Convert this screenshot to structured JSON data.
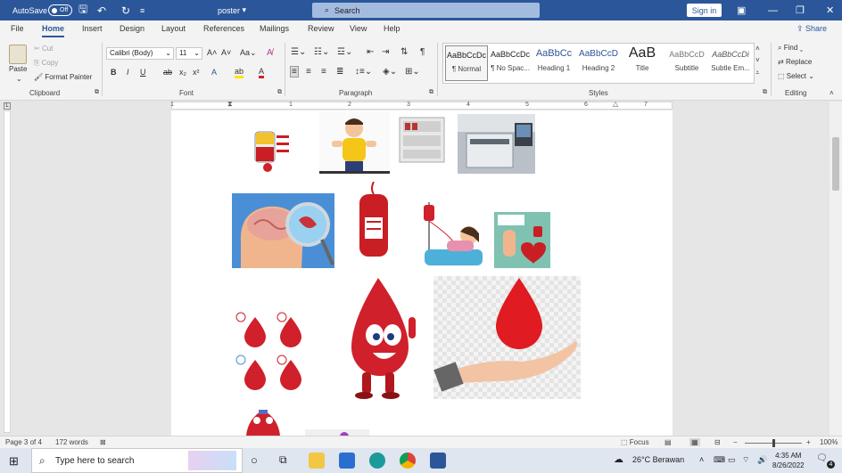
{
  "titlebar": {
    "autosave_label": "AutoSave",
    "autosave_state": "Off",
    "doc_title": "poster",
    "doc_title_caret": "▾",
    "search_placeholder": "Search",
    "sign_in": "Sign in"
  },
  "menu": {
    "tabs": [
      "File",
      "Home",
      "Insert",
      "Design",
      "Layout",
      "References",
      "Mailings",
      "Review",
      "View",
      "Help"
    ],
    "active": "Home",
    "share": "Share"
  },
  "ribbon": {
    "clipboard": {
      "paste": "Paste",
      "cut": "Cut",
      "copy": "Copy",
      "format_painter": "Format Painter",
      "label": "Clipboard"
    },
    "font": {
      "name": "Calibri (Body)",
      "size": "11",
      "label": "Font"
    },
    "paragraph": {
      "label": "Paragraph"
    },
    "styles": {
      "label": "Styles",
      "items": [
        {
          "sample": "AaBbCcDc",
          "name": "¶ Normal"
        },
        {
          "sample": "AaBbCcDc",
          "name": "¶ No Spac..."
        },
        {
          "sample": "AaBbCc",
          "name": "Heading 1"
        },
        {
          "sample": "AaBbCcD",
          "name": "Heading 2"
        },
        {
          "sample": "AaB",
          "name": "Title"
        },
        {
          "sample": "AaBbCcD",
          "name": "Subtitle"
        },
        {
          "sample": "AaBbCcDi",
          "name": "Subtle Em..."
        }
      ]
    },
    "editing": {
      "find": "Find",
      "replace": "Replace",
      "select": "Select",
      "label": "Editing"
    }
  },
  "ruler": {
    "numbers": [
      "1",
      "1",
      "2",
      "3",
      "4",
      "5",
      "6",
      "7"
    ]
  },
  "statusbar": {
    "page": "Page 3 of 4",
    "words": "172 words",
    "focus": "Focus",
    "zoom": "100%",
    "zoom_level": 1.0
  },
  "taskbar": {
    "search_placeholder": "Type here to search",
    "weather": "26°C  Berawan",
    "time": "4:35 AM",
    "date": "8/26/2022",
    "notifications": "4"
  },
  "colors": {
    "word_blue": "#2b579a",
    "blood_red": "#d0202b"
  }
}
